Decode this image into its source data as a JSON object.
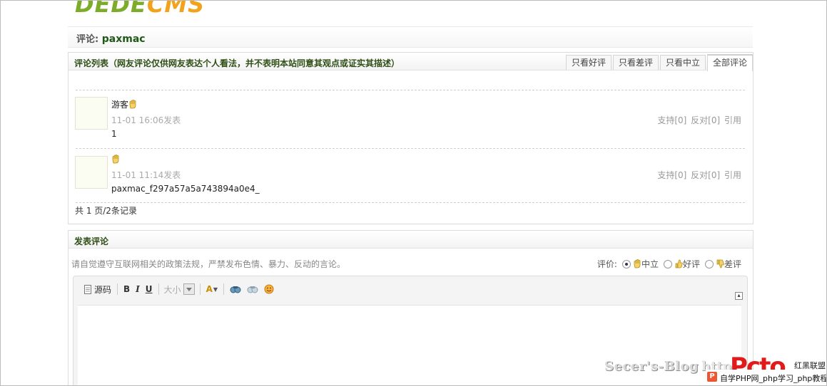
{
  "logo": {
    "part1": "DEDE",
    "part2": "CMS"
  },
  "header": {
    "label": "评论:",
    "name": "paxmac"
  },
  "comments_panel": {
    "title": "评论列表（网友评论仅供网友表达个人看法，并不表明本站同意其观点或证实其描述）",
    "tabs": [
      "只看好评",
      "只看差评",
      "只看中立",
      "全部评论"
    ],
    "active_tab": 3,
    "items": [
      {
        "user": "游客",
        "time": "11-01 16:06发表",
        "body": "1",
        "support": "支持[0]",
        "oppose": "反对[0]",
        "quote": "引用"
      },
      {
        "user": "",
        "time": "11-01 11:14发表",
        "body": "paxmac_f297a57a5a743894a0e4_",
        "support": "支持[0]",
        "oppose": "反对[0]",
        "quote": "引用"
      }
    ],
    "pager": "共 1 页/2条记录"
  },
  "post_panel": {
    "title": "发表评论",
    "notice": "请自觉遵守互联网相关的政策法规，严禁发布色情、暴力、反动的言论。",
    "rating_label": "评价:",
    "rating_options": [
      "中立",
      "好评",
      "差评"
    ],
    "rating_selected": "中立",
    "toolbar": {
      "source": "源码",
      "bold": "B",
      "italic": "I",
      "underline": "U",
      "size": "大小",
      "font_color": "A"
    }
  },
  "watermark": {
    "blog": "Secer's-Blog",
    "http": "http",
    "brand": "Pcto",
    "site": "红黑联盟",
    "footer": "自学PHP网_php学习_php教程"
  }
}
